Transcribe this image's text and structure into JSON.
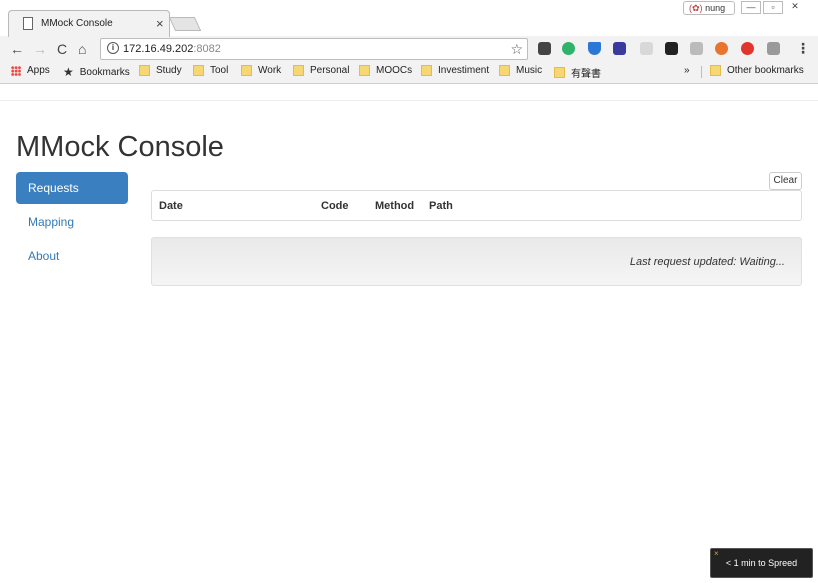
{
  "browser": {
    "tab_title": "MMock Console",
    "tab_close": "×",
    "user_badge": "nung",
    "url_host": "172.16.49.202",
    "url_port": ":8082",
    "bookmarks": {
      "apps": "Apps",
      "items": [
        "Bookmarks",
        "Study",
        "Tool",
        "Work",
        "Personal",
        "MOOCs",
        "Investiment",
        "Music",
        "有聲書"
      ],
      "overflow": "»",
      "other": "Other bookmarks"
    }
  },
  "app": {
    "title": "MMock Console",
    "nav": [
      "Requests",
      "Mapping",
      "About"
    ],
    "clear_label": "Clear",
    "table_headers": [
      "Date",
      "Code",
      "Method",
      "Path"
    ],
    "status_text": "Last request updated: Waiting..."
  },
  "toast": {
    "label": "< 1 min to Spreed"
  },
  "colors": {
    "accent": "#3a80c0",
    "link": "#337ab7"
  }
}
